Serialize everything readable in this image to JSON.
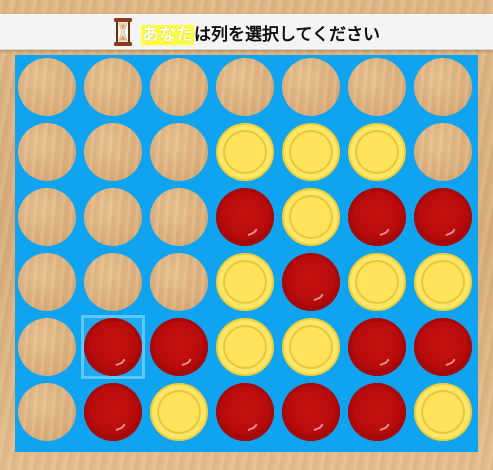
{
  "header": {
    "player_name": "あなた",
    "status_text": "は列を選択してください",
    "icon": "hourglass-icon"
  },
  "board": {
    "columns": 7,
    "rows": 6,
    "cells": [
      [
        "empty",
        "empty",
        "empty",
        "empty",
        "empty",
        "empty",
        "empty"
      ],
      [
        "empty",
        "empty",
        "empty",
        "yellow",
        "yellow",
        "yellow",
        "empty"
      ],
      [
        "empty",
        "empty",
        "empty",
        "red",
        "yellow",
        "red",
        "red"
      ],
      [
        "empty",
        "empty",
        "empty",
        "yellow",
        "red",
        "yellow",
        "yellow"
      ],
      [
        "empty",
        "red",
        "red",
        "yellow",
        "yellow",
        "red",
        "red"
      ],
      [
        "empty",
        "red",
        "yellow",
        "red",
        "red",
        "red",
        "yellow"
      ]
    ],
    "highlighted_cell": {
      "row": 5,
      "column": 2
    },
    "colors": {
      "board": "#10a4f0",
      "red_disc": "#b80c0c",
      "yellow_disc": "#ffe35a",
      "highlight": "#5cc8ff"
    }
  }
}
